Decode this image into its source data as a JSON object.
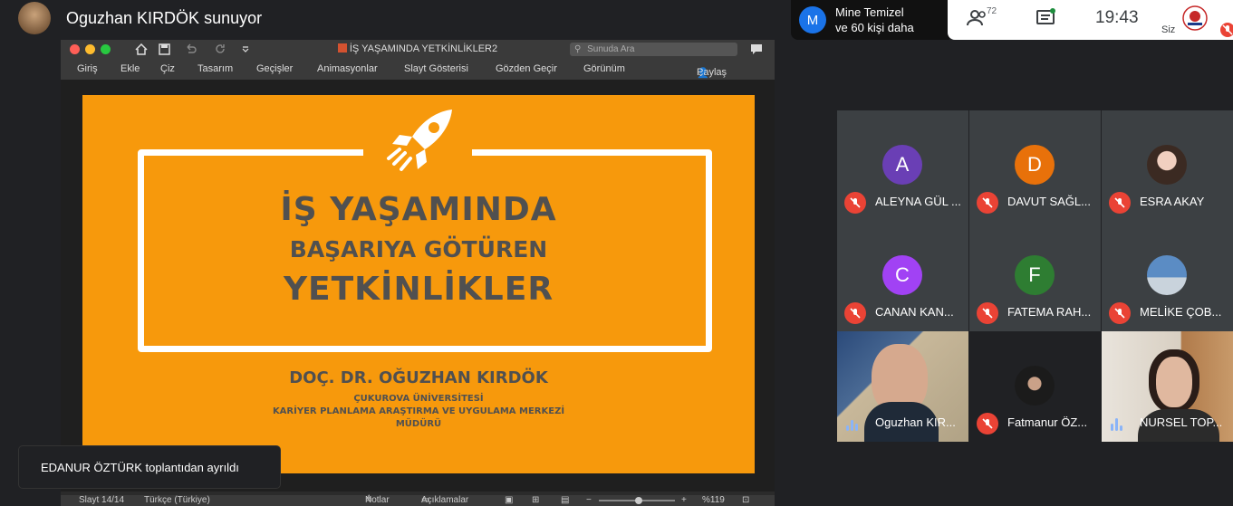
{
  "header": {
    "presenter_label": "Oguzhan KIRDÖK sunuyor"
  },
  "others": {
    "initial": "M",
    "line1": "Mine Temizel",
    "line2": "ve 60 kişi daha"
  },
  "topbar": {
    "people_count": "72",
    "time": "19:43",
    "self_label": "Siz"
  },
  "ppt": {
    "title": "İŞ YAŞAMINDA  YETKİNLİKLER2",
    "search_placeholder": "Sunuda Ara",
    "ribbon": [
      "Giriş",
      "Ekle",
      "Çiz",
      "Tasarım",
      "Geçişler",
      "Animasyonlar",
      "Slayt Gösterisi",
      "Gözden Geçir",
      "Görünüm"
    ],
    "share": "Paylaş",
    "status": {
      "slide": "Slayt 14/14",
      "lang": "Türkçe (Türkiye)",
      "notes": "Notlar",
      "comments": "Açıklamalar",
      "zoom": "%119"
    }
  },
  "slide": {
    "line1": "İŞ YAŞAMINDA",
    "line2": "BAŞARIYA GÖTÜREN",
    "line3": "YETKİNLİKLER",
    "author": "DOÇ. DR. OĞUZHAN KIRDÖK",
    "org1": "ÇUKUROVA ÜNİVERSİTESİ",
    "org2": "KARİYER PLANLAMA ARAŞTIRMA VE UYGULAMA MERKEZİ",
    "org3": "MÜDÜRÜ",
    "accent": "#f7990c"
  },
  "toast": {
    "text": "EDANUR ÖZTÜRK toplantıdan ayrıldı"
  },
  "participants": [
    {
      "name": "ALEYNA GÜL ...",
      "initial": "A",
      "color": "#6a3fb5",
      "muted": true
    },
    {
      "name": "DAVUT SAĞL...",
      "initial": "D",
      "color": "#e8710a",
      "muted": true
    },
    {
      "name": "ESRA AKAY",
      "initial": "",
      "color": "",
      "muted": true
    },
    {
      "name": "CANAN KAN...",
      "initial": "C",
      "color": "#a142f4",
      "muted": true
    },
    {
      "name": "FATEMA RAH...",
      "initial": "F",
      "color": "#2e7d32",
      "muted": true
    },
    {
      "name": "MELİKE ÇOB...",
      "initial": "",
      "color": "",
      "muted": true
    },
    {
      "name": "Oguzhan KIR...",
      "initial": "",
      "color": "",
      "muted": false
    },
    {
      "name": "Fatmanur ÖZ...",
      "initial": "",
      "color": "",
      "muted": true
    },
    {
      "name": "NURSEL TOP...",
      "initial": "",
      "color": "",
      "muted": false
    }
  ]
}
